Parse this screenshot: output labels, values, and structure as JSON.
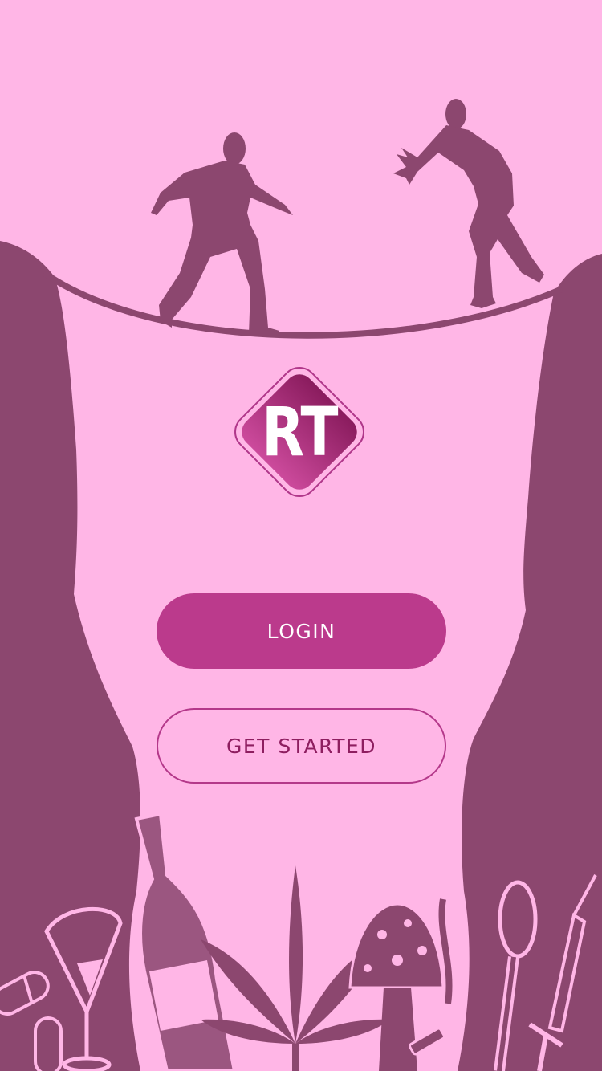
{
  "logo": {
    "text": "RT"
  },
  "buttons": {
    "login_label": "LOGIN",
    "get_started_label": "GET STARTED"
  },
  "colors": {
    "background": "#ffb6e6",
    "silhouette": "#8c476f",
    "primary_button": "#bb3a8c",
    "outline_button_border": "#b4388a",
    "outline_button_text": "#8e1e60"
  },
  "icons": [
    "cliff-left-silhouette",
    "cliff-right-silhouette",
    "rope-bridge-icon",
    "walking-man-icon",
    "reaching-man-icon",
    "pill-icon",
    "cocktail-glass-icon",
    "wine-bottle-icon",
    "cannabis-leaf-icon",
    "mushroom-icon",
    "cigarette-icon",
    "spoon-icon",
    "syringe-icon"
  ]
}
